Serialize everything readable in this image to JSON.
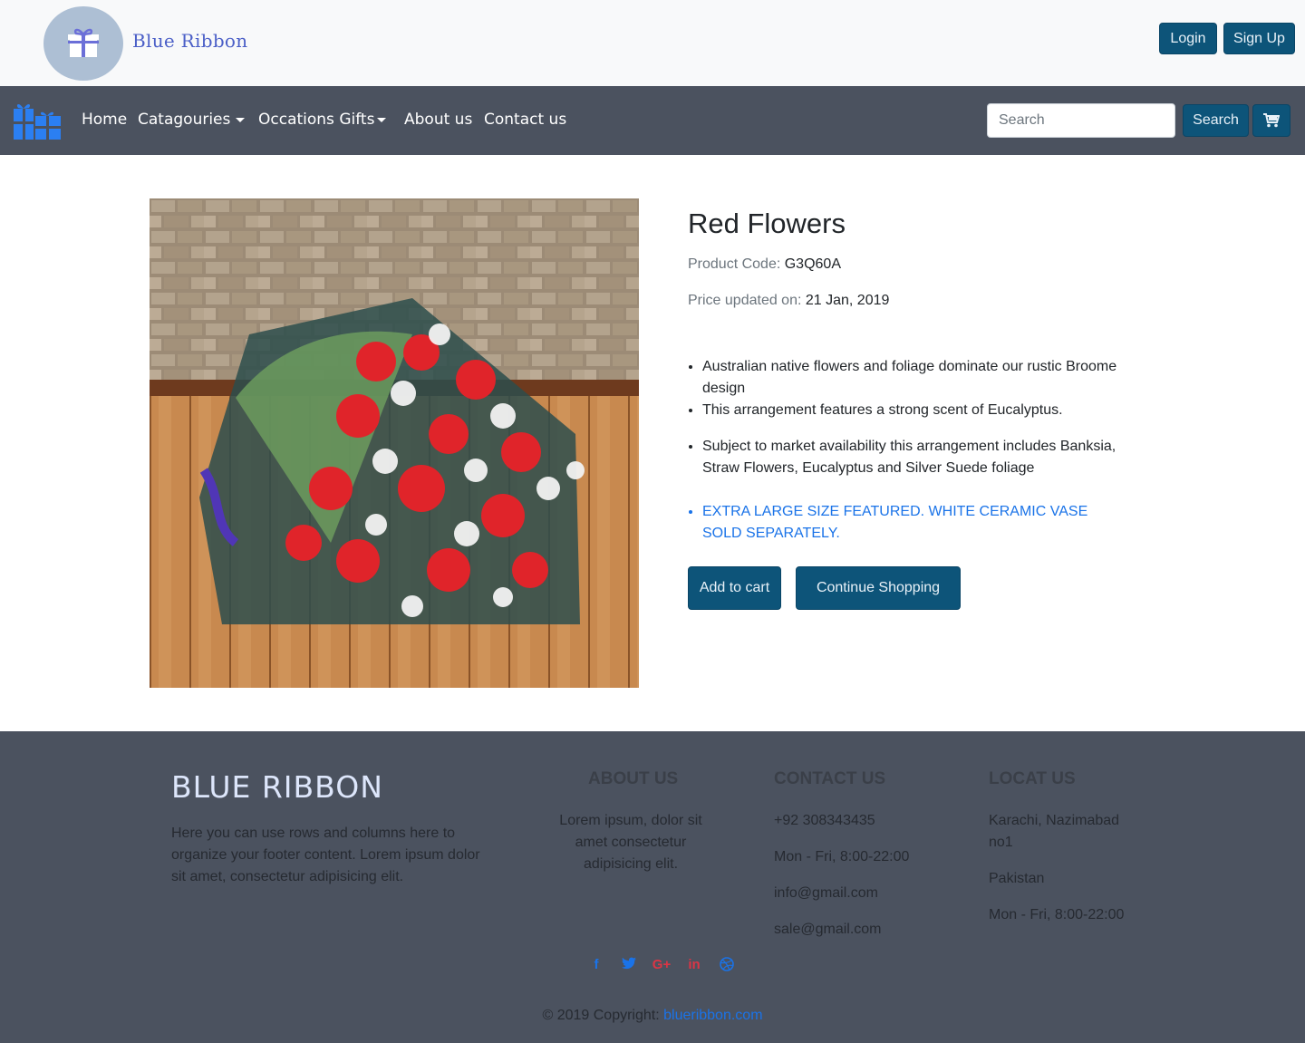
{
  "header": {
    "brand_name": "Blue Ribbon",
    "login_label": "Login",
    "signup_label": "Sign Up"
  },
  "nav": {
    "items": [
      {
        "label": "Home"
      },
      {
        "label": "Catagouries"
      },
      {
        "label": "Occations Gifts"
      },
      {
        "label": "About us"
      },
      {
        "label": "Contact us"
      }
    ],
    "search_placeholder": "Search",
    "search_button": "Search",
    "cart_icon": "cart-icon"
  },
  "product": {
    "title": "Red Flowers",
    "code_label": "Product Code:",
    "code_value": "G3Q60A",
    "price_label": "Price updated on:",
    "price_date": "21 Jan, 2019",
    "features": [
      "Australian native flowers and foliage dominate our rustic Broome design",
      "This arrangement features a strong scent of Eucalyptus.",
      "Subject to market availability this arrangement includes Banksia, Straw Flowers, Eucalyptus and Silver Suede foliage",
      "EXTRA LARGE SIZE FEATURED. WHITE CERAMIC VASE SOLD SEPARATELY."
    ],
    "add_to_cart": "Add to cart",
    "continue_shopping": "Continue Shopping"
  },
  "footer": {
    "brand": "BLUE RIBBON",
    "brand_text": "Here you can use rows and columns here to organize your footer content. Lorem ipsum dolor sit amet, consectetur adipisicing elit.",
    "about_heading": "ABOUT US",
    "about_text": "Lorem ipsum, dolor sit amet consectetur adipisicing elit.",
    "contact_heading": "CONTACT US",
    "contact": [
      "+92 308343435",
      "Mon - Fri, 8:00-22:00",
      "info@gmail.com",
      "sale@gmail.com"
    ],
    "locate_heading": "LOCAT US",
    "locate": [
      "Karachi, Nazimabad no1",
      "Pakistan",
      "Mon - Fri, 8:00-22:00"
    ],
    "social": [
      {
        "icon": "facebook-icon",
        "glyph": "f",
        "color": "#1a73e8"
      },
      {
        "icon": "twitter-icon",
        "glyph": "🐦",
        "color": "#1a73e8"
      },
      {
        "icon": "google-plus-icon",
        "glyph": "G+",
        "color": "#dc3545"
      },
      {
        "icon": "linkedin-icon",
        "glyph": "in",
        "color": "#dc3545"
      },
      {
        "icon": "dribbble-icon",
        "glyph": "◍",
        "color": "#1a73e8"
      }
    ],
    "copyright_text": "© 2019 Copyright:",
    "copyright_link": "blueribbon.com"
  },
  "colors": {
    "primary_button": "#0d5479",
    "navbar": "#4b525f",
    "link": "#1a73e8"
  }
}
